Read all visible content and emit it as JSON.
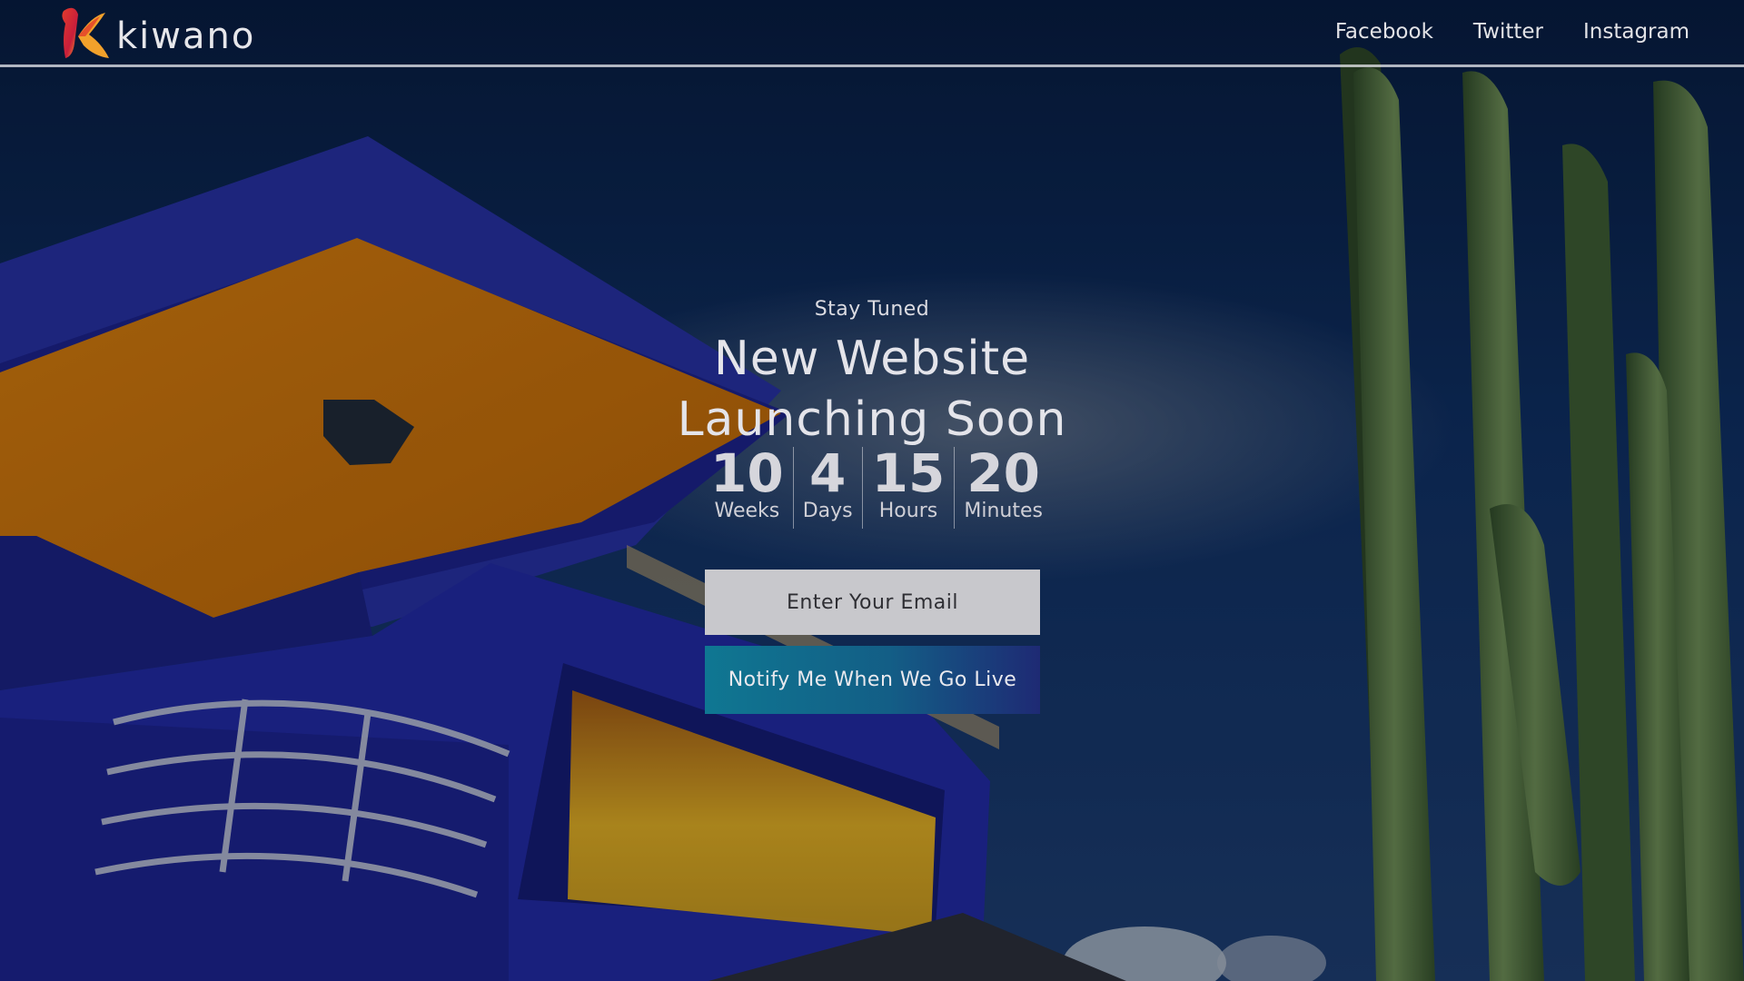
{
  "brand": {
    "name": "kiwano"
  },
  "nav": {
    "facebook": "Facebook",
    "twitter": "Twitter",
    "instagram": "Instagram"
  },
  "hero": {
    "eyebrow": "Stay Tuned",
    "headline_line1": "New Website",
    "headline_line2": "Launching Soon"
  },
  "countdown": [
    {
      "value": "10",
      "label": "Weeks"
    },
    {
      "value": "4",
      "label": "Days"
    },
    {
      "value": "15",
      "label": "Hours"
    },
    {
      "value": "20",
      "label": "Minutes"
    }
  ],
  "form": {
    "email_placeholder": "Enter Your Email",
    "notify_label": "Notify Me When We Go Live"
  },
  "colors": {
    "sky": "#0c2a5e",
    "building_blue": "#22299a",
    "ceiling_orange": "#c4700a",
    "cactus_green": "#4c6b3b",
    "button_start": "#0f7792",
    "button_end": "#1e2a74"
  }
}
